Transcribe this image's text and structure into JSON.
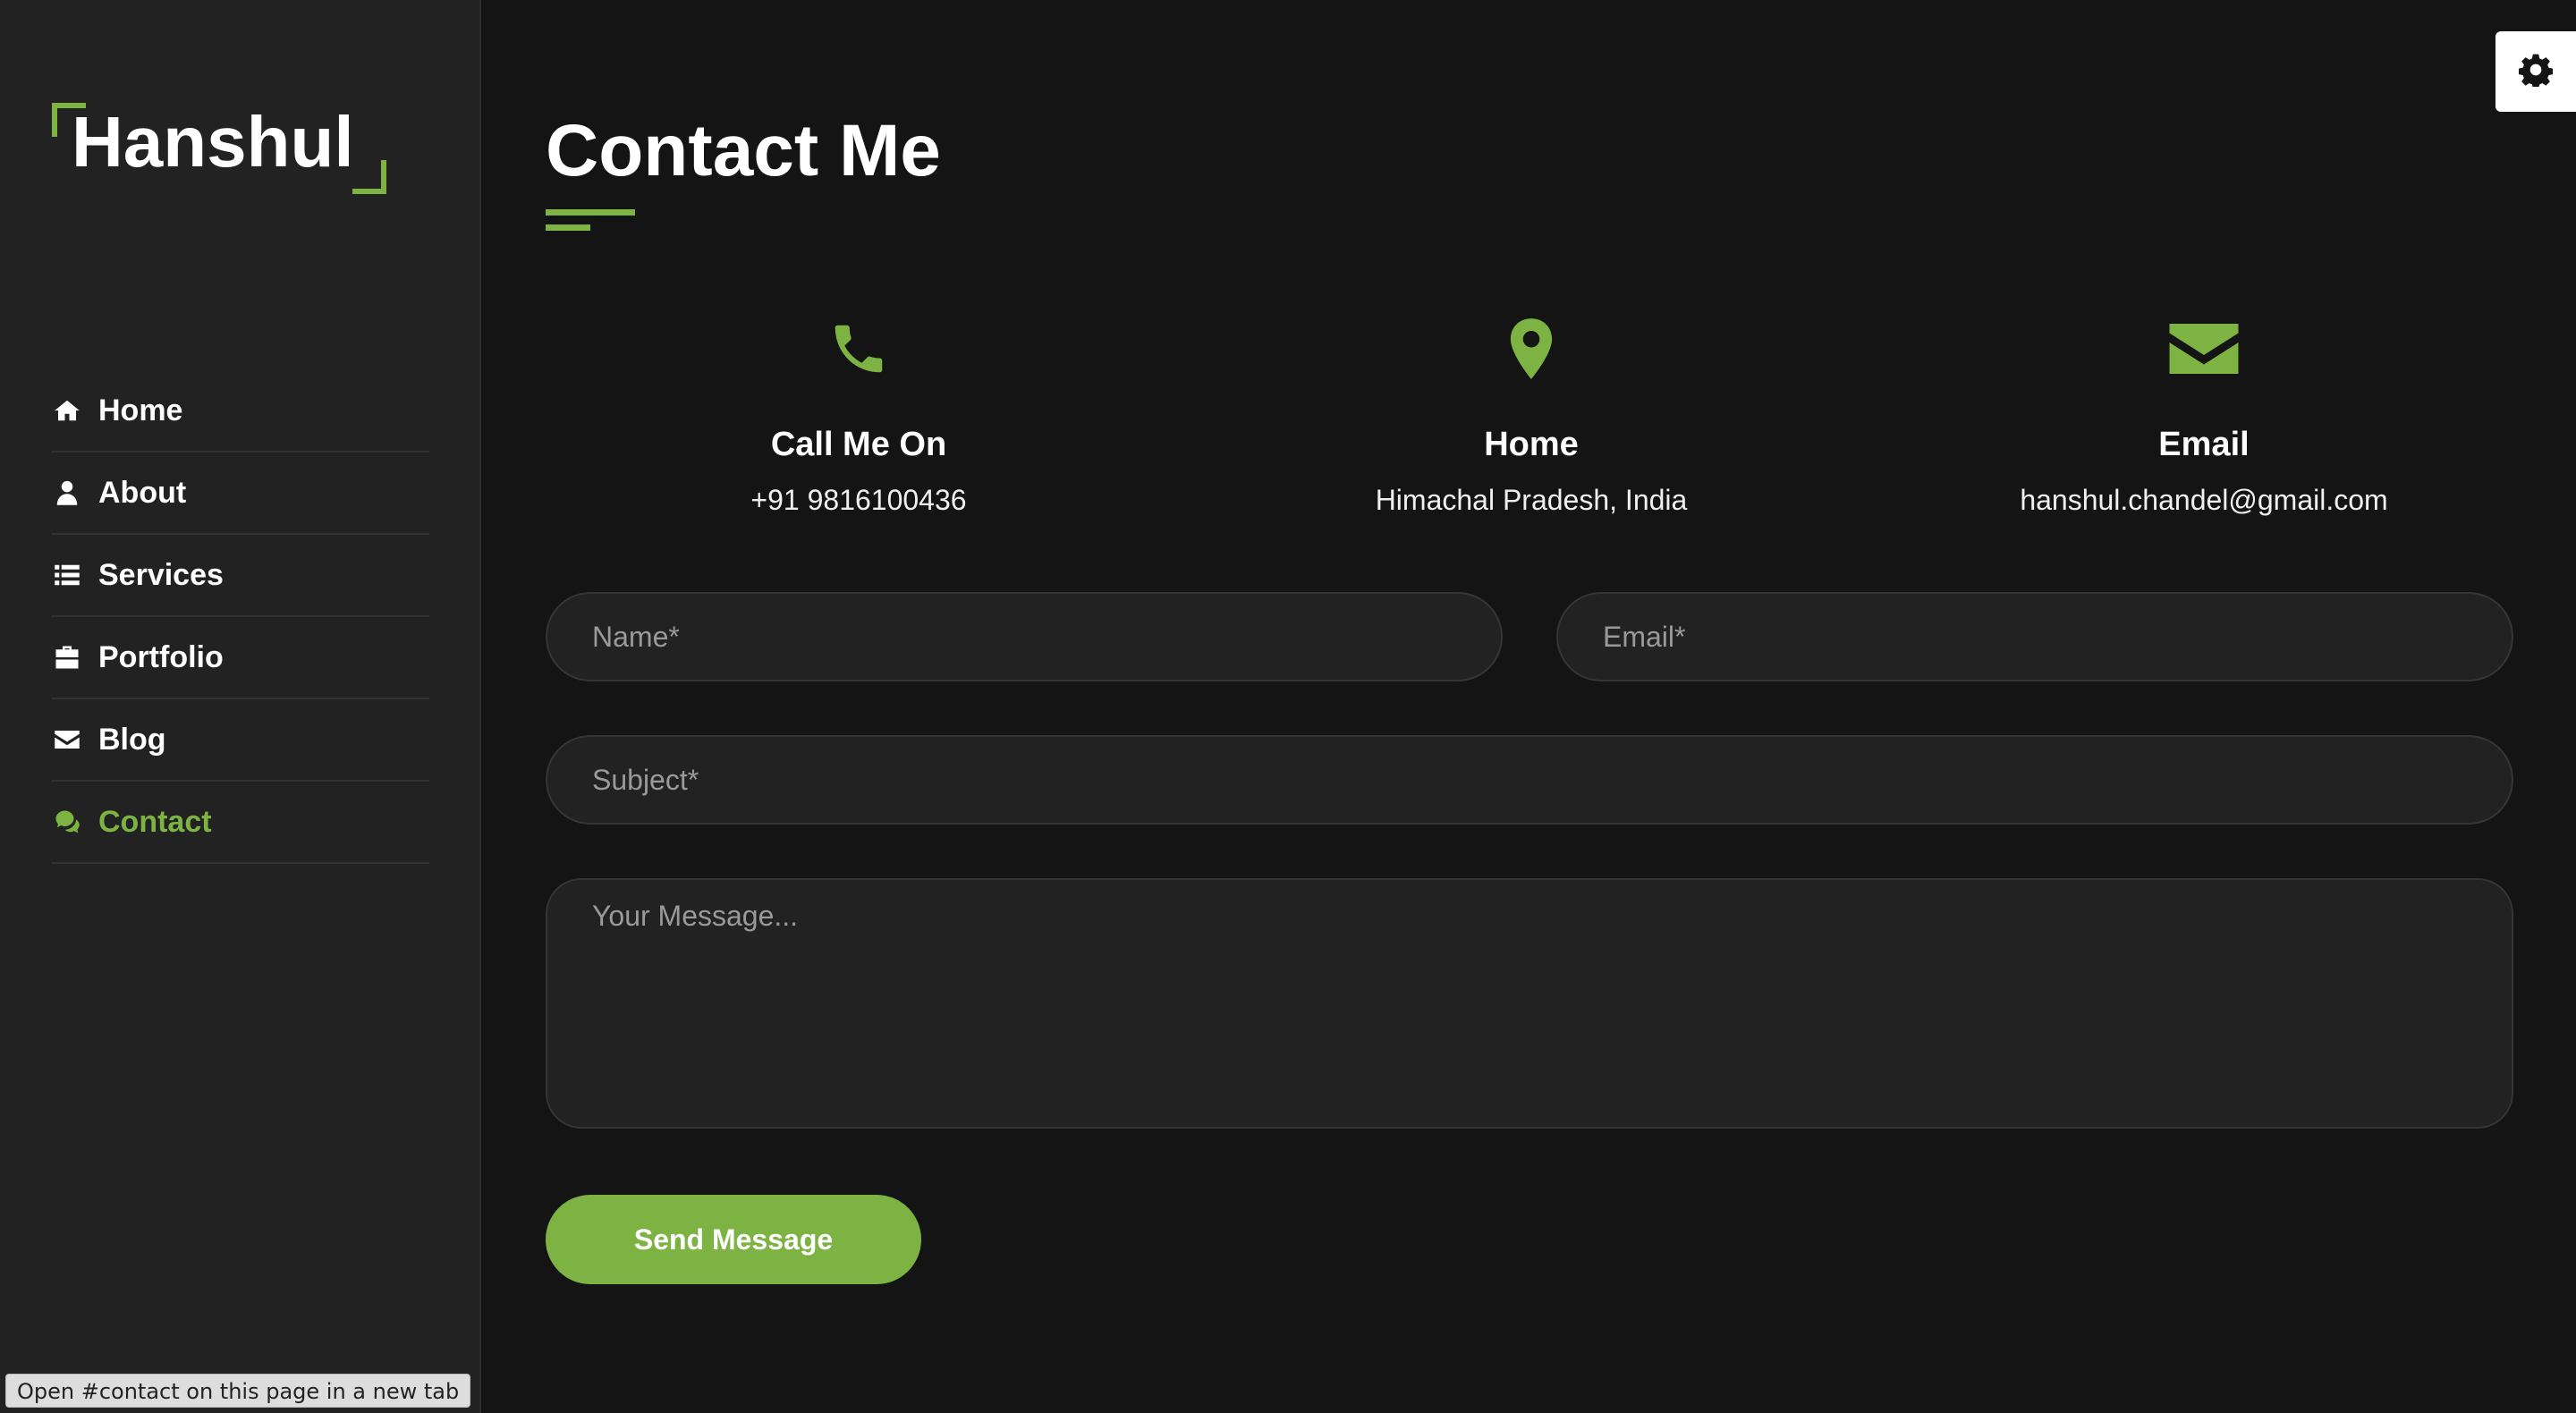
{
  "brand": {
    "name": "Hanshul",
    "accent": "#7cb342"
  },
  "sidebar": {
    "items": [
      {
        "label": "Home",
        "icon": "home-icon"
      },
      {
        "label": "About",
        "icon": "user-icon"
      },
      {
        "label": "Services",
        "icon": "list-icon"
      },
      {
        "label": "Portfolio",
        "icon": "briefcase-icon"
      },
      {
        "label": "Blog",
        "icon": "envelope-icon"
      },
      {
        "label": "Contact",
        "icon": "comments-icon",
        "active": true
      }
    ]
  },
  "status_tip": "Open #contact on this page in a new tab",
  "settings": {
    "icon": "gear-icon"
  },
  "page": {
    "title": "Contact Me"
  },
  "contact_info": [
    {
      "icon": "phone-icon",
      "label": "Call Me On",
      "value": "+91 9816100436"
    },
    {
      "icon": "map-marker-icon",
      "label": "Home",
      "value": "Himachal Pradesh, India"
    },
    {
      "icon": "envelope-icon",
      "label": "Email",
      "value": "hanshul.chandel@gmail.com"
    }
  ],
  "form": {
    "name_placeholder": "Name*",
    "email_placeholder": "Email*",
    "subject_placeholder": "Subject*",
    "message_placeholder": "Your Message...",
    "submit_label": "Send Message"
  }
}
